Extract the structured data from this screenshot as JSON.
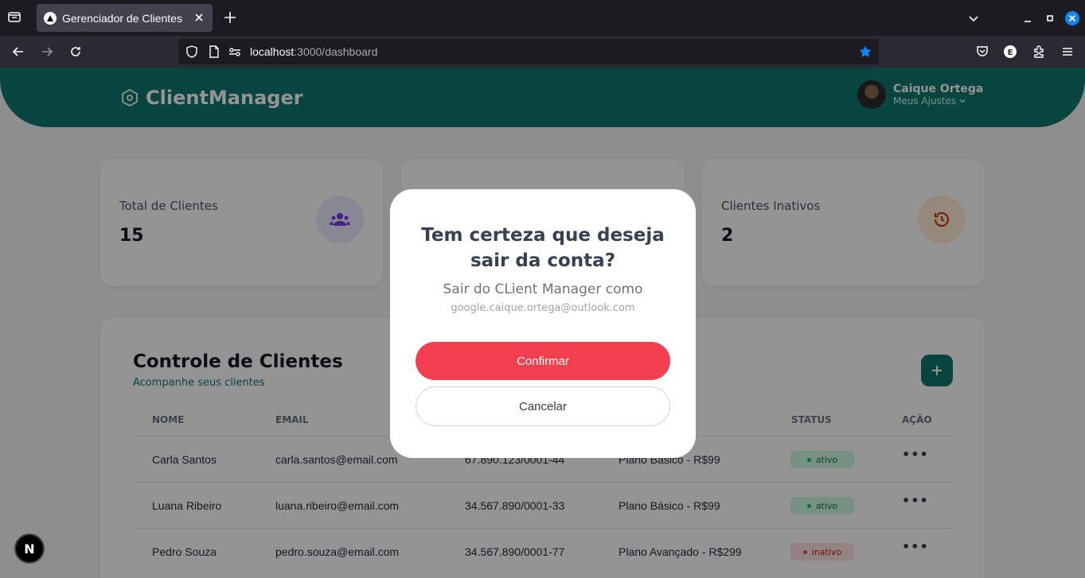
{
  "browser": {
    "tab_title": "Gerenciador de Clientes",
    "url_host": "localhost",
    "url_path": ":3000/dashboard"
  },
  "header": {
    "logo": "ClientManager",
    "user_name": "Caique Ortega",
    "user_sub": "Meus Ajustes"
  },
  "stats": [
    {
      "label": "Total de Clientes",
      "value": "15",
      "icon": "users-icon",
      "color": "#7c3aed"
    },
    {
      "label": "Clientes Inativos",
      "value": "2",
      "icon": "history-icon",
      "color": "#c2410c"
    }
  ],
  "table": {
    "title": "Controle de Clientes",
    "subtitle": "Acompanhe seus clientes",
    "headers": [
      "NOME",
      "EMAIL",
      "STATUS",
      "AÇÃO"
    ],
    "rows": [
      {
        "name": "Carla Santos",
        "email": "carla.santos@email.com",
        "cnpj": "67.890.123/0001-44",
        "plan": "Plano Básico - R$99",
        "status": "ativo"
      },
      {
        "name": "Luana Ribeiro",
        "email": "luana.ribeiro@email.com",
        "cnpj": "34.567.890/0001-33",
        "plan": "Plano Básico - R$99",
        "status": "ativo"
      },
      {
        "name": "Pedro Souza",
        "email": "pedro.souza@email.com",
        "cnpj": "34.567.890/0001-77",
        "plan": "Plano Avançado - R$299",
        "status": "inativo"
      }
    ]
  },
  "modal": {
    "title": "Tem certeza que deseja sair da conta?",
    "as_text": "Sair do CLient Manager como",
    "email": "google.caique.ortega@outlook.com",
    "confirm": "Confirmar",
    "cancel": "Cancelar"
  },
  "next_badge": "N"
}
